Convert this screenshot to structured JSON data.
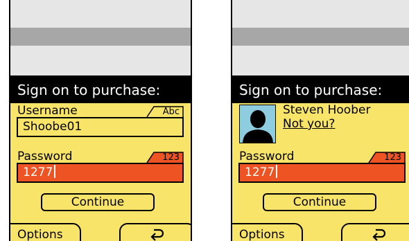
{
  "colors": {
    "screen_bg": "#e6e6e6",
    "status_bar": "#a7a7a7",
    "dialog_bg": "#f9e46a",
    "active_field": "#ee5324",
    "title_bg": "#000000",
    "avatar_bg": "#8ecde0"
  },
  "left_screen": {
    "title": "Sign on to purchase:",
    "username_label": "Username",
    "username_mode": "Abc",
    "username_value": "Shoobe01",
    "password_label": "Password",
    "password_mode": "123",
    "password_value": "1277",
    "continue_label": "Continue",
    "softkey_left": "Options",
    "softkey_right_icon": "back-arrow-icon"
  },
  "right_screen": {
    "title": "Sign on to purchase:",
    "user_name": "Steven Hoober",
    "not_you_link": "Not you?",
    "avatar_icon": "person-silhouette-icon",
    "password_label": "Password",
    "password_mode": "123",
    "password_value": "1277",
    "continue_label": "Continue",
    "softkey_left": "Options",
    "softkey_right_icon": "back-arrow-icon"
  }
}
